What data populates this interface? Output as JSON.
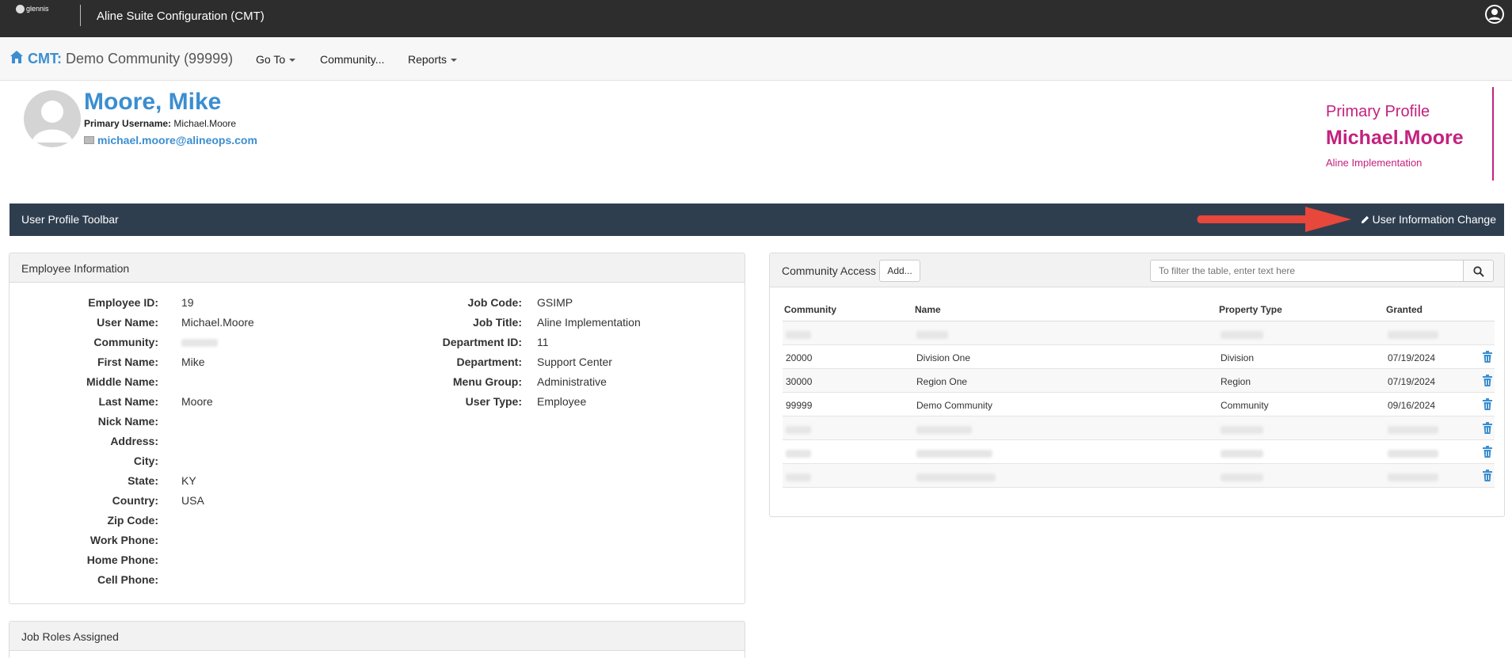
{
  "topbar": {
    "logo_text": "glennis",
    "app_title": "Aline Suite Configuration (CMT)"
  },
  "navbar": {
    "brand_prefix": "CMT:",
    "brand_community": "Demo Community (99999)",
    "items": [
      {
        "label": "Go To",
        "has_caret": true
      },
      {
        "label": "Community...",
        "has_caret": false
      },
      {
        "label": "Reports",
        "has_caret": true
      }
    ]
  },
  "profile": {
    "name": "Moore, Mike",
    "primary_username_label": "Primary Username:",
    "primary_username": "Michael.Moore",
    "email": "michael.moore@alineops.com",
    "primary_profile_label": "Primary Profile",
    "primary_profile_user": "Michael.Moore",
    "primary_profile_role": "Aline Implementation"
  },
  "toolbar": {
    "title": "User Profile Toolbar",
    "action_label": "User Information Change"
  },
  "employee_info": {
    "title": "Employee Information",
    "left": [
      {
        "label": "Employee ID:",
        "value": "19"
      },
      {
        "label": "User Name:",
        "value": "Michael.Moore"
      },
      {
        "label": "Community:",
        "value": "",
        "blurred": true
      },
      {
        "label": "First Name:",
        "value": "Mike"
      },
      {
        "label": "Middle Name:",
        "value": ""
      },
      {
        "label": "Last Name:",
        "value": "Moore"
      },
      {
        "label": "Nick Name:",
        "value": ""
      },
      {
        "label": "Address:",
        "value": ""
      },
      {
        "label": "City:",
        "value": ""
      },
      {
        "label": "State:",
        "value": "KY"
      },
      {
        "label": "Country:",
        "value": "USA"
      },
      {
        "label": "Zip Code:",
        "value": ""
      },
      {
        "label": "Work Phone:",
        "value": ""
      },
      {
        "label": "Home Phone:",
        "value": ""
      },
      {
        "label": "Cell Phone:",
        "value": ""
      }
    ],
    "right": [
      {
        "label": "Job Code:",
        "value": "GSIMP"
      },
      {
        "label": "Job Title:",
        "value": "Aline Implementation"
      },
      {
        "label": "Department ID:",
        "value": "11"
      },
      {
        "label": "Department:",
        "value": "Support Center"
      },
      {
        "label": "Menu Group:",
        "value": "Administrative"
      },
      {
        "label": "User Type:",
        "value": "Employee"
      }
    ]
  },
  "job_roles": {
    "title": "Job Roles Assigned"
  },
  "community_access": {
    "title": "Community Access",
    "add_label": "Add...",
    "filter_placeholder": "To filter the table, enter text here",
    "columns": [
      "Community",
      "Name",
      "Property Type",
      "Granted"
    ],
    "rows": [
      {
        "community": "",
        "name": "",
        "type": "",
        "granted": "",
        "blurred": true,
        "deletable": false
      },
      {
        "community": "20000",
        "name": "Division One",
        "type": "Division",
        "granted": "07/19/2024",
        "blurred": false,
        "deletable": true
      },
      {
        "community": "30000",
        "name": "Region One",
        "type": "Region",
        "granted": "07/19/2024",
        "blurred": false,
        "deletable": true
      },
      {
        "community": "99999",
        "name": "Demo Community",
        "type": "Community",
        "granted": "09/16/2024",
        "blurred": false,
        "deletable": true
      },
      {
        "community": "",
        "name": "",
        "type": "",
        "granted": "",
        "blurred": true,
        "deletable": true
      },
      {
        "community": "",
        "name": "",
        "type": "",
        "granted": "",
        "blurred": true,
        "deletable": true
      },
      {
        "community": "",
        "name": "",
        "type": "",
        "granted": "",
        "blurred": true,
        "deletable": true
      }
    ]
  },
  "colors": {
    "topbar": "#2d2d2d",
    "brand_blue": "#3b8ed0",
    "primary_magenta": "#c3227e",
    "toolbar": "#2f3e4f",
    "annotation_arrow": "#e8473b"
  }
}
